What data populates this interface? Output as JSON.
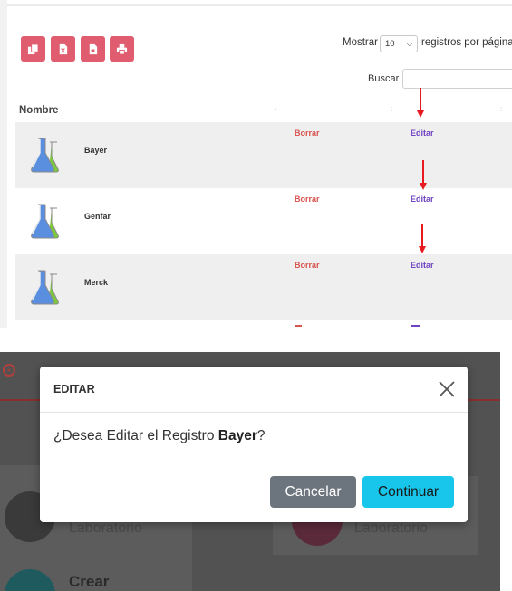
{
  "toolbar": {
    "buttons": [
      {
        "name": "copy-icon",
        "label": ""
      },
      {
        "name": "excel-icon",
        "label": ""
      },
      {
        "name": "pdf-icon",
        "label": ""
      },
      {
        "name": "print-icon",
        "label": ""
      }
    ],
    "show_prefix": "Mostrar",
    "page_length": "10",
    "show_suffix": "registros por página",
    "search_label": "Buscar",
    "search_value": ""
  },
  "table": {
    "columns": [
      "Nombre",
      "",
      "",
      ""
    ],
    "rows": [
      {
        "name": "Bayer",
        "delete_label": "Borrar",
        "edit_label": "Editar"
      },
      {
        "name": "Genfar",
        "delete_label": "Borrar",
        "edit_label": "Editar"
      },
      {
        "name": "Merck",
        "delete_label": "Borrar",
        "edit_label": "Editar"
      }
    ]
  },
  "background_page": {
    "card_label_1": "Laboratorio",
    "card_label_2": "Laboratorio",
    "create_label": "Crear"
  },
  "modal": {
    "title": "EDITAR",
    "message_prefix": "¿Desea Editar el Registro ",
    "record_name": "Bayer",
    "message_suffix": "?",
    "cancel_label": "Cancelar",
    "continue_label": "Continuar"
  },
  "colors": {
    "export_button": "#e05d6f",
    "delete_link": "#d9534f",
    "edit_link": "#6f42c1",
    "cancel_button": "#6c757d",
    "continue_button": "#17c6ea",
    "annotation_arrow": "#e8191f"
  }
}
